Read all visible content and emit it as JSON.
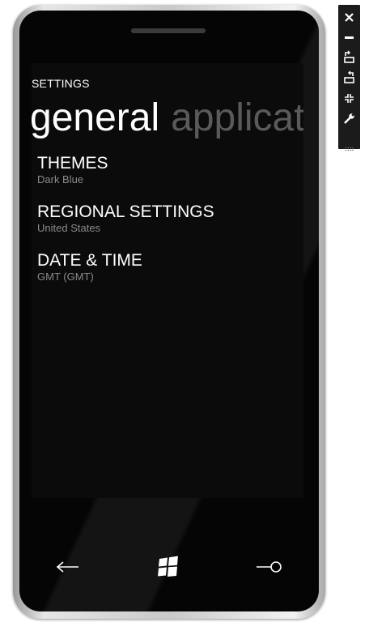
{
  "screen": {
    "app_title": "SETTINGS",
    "pivot": {
      "tabs": [
        {
          "label": "general",
          "active": true
        },
        {
          "label": "applicat",
          "active": false
        }
      ]
    },
    "items": [
      {
        "title": "THEMES",
        "value": "Dark Blue"
      },
      {
        "title": "REGIONAL SETTINGS",
        "value": "United States"
      },
      {
        "title": "DATE & TIME",
        "value": "GMT (GMT)"
      }
    ]
  },
  "hardware_buttons": {
    "back": "back-arrow-icon",
    "start": "windows-logo-icon",
    "search": "search-icon"
  },
  "emulator_toolbar": {
    "tools": [
      "close-icon",
      "minimize-icon",
      "rotate-left-icon",
      "rotate-right-icon",
      "fit-to-screen-icon",
      "tools-wrench-icon"
    ]
  },
  "colors": {
    "screen_background": "#0b0b0b",
    "text_primary": "#ffffff",
    "text_secondary": "#8a8a8a",
    "pivot_inactive": "#5a5a5a",
    "toolbar_background": "#1b1b1b"
  }
}
